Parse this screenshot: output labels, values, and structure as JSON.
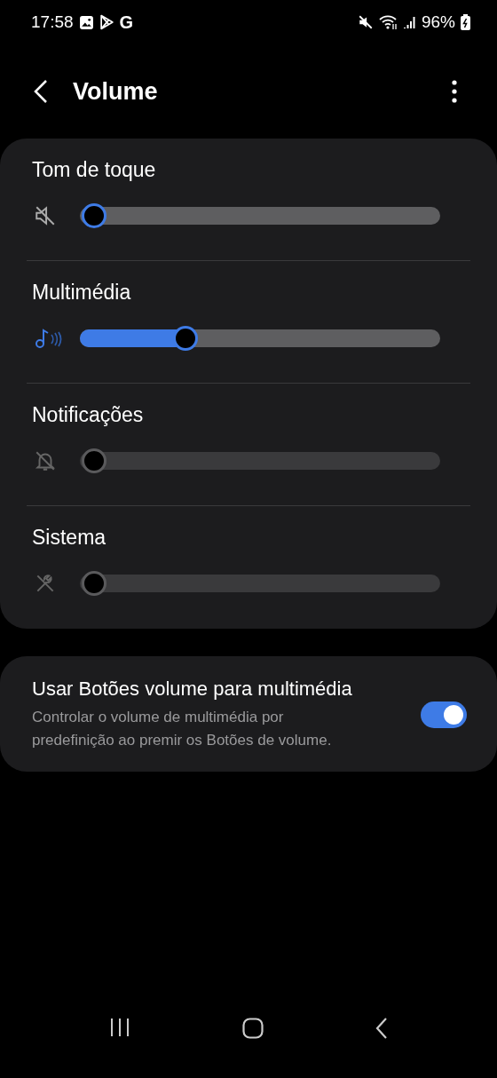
{
  "status_bar": {
    "time": "17:58",
    "app_letter": "G",
    "battery": "96%"
  },
  "header": {
    "title": "Volume"
  },
  "sliders": [
    {
      "label": "Tom de toque",
      "kind": "speaker-muted",
      "disabled": false,
      "level": 0
    },
    {
      "label": "Multimédia",
      "kind": "music",
      "disabled": false,
      "level": 0.27
    },
    {
      "label": "Notificações",
      "kind": "bell-off",
      "disabled": true,
      "level": 0
    },
    {
      "label": "Sistema",
      "kind": "wrench-off",
      "disabled": true,
      "level": 0
    }
  ],
  "setting": {
    "title": "Usar Botões volume para multimédia",
    "description": "Controlar o volume de multimédia por predefinição ao premir os Botões de volume.",
    "on": true
  }
}
